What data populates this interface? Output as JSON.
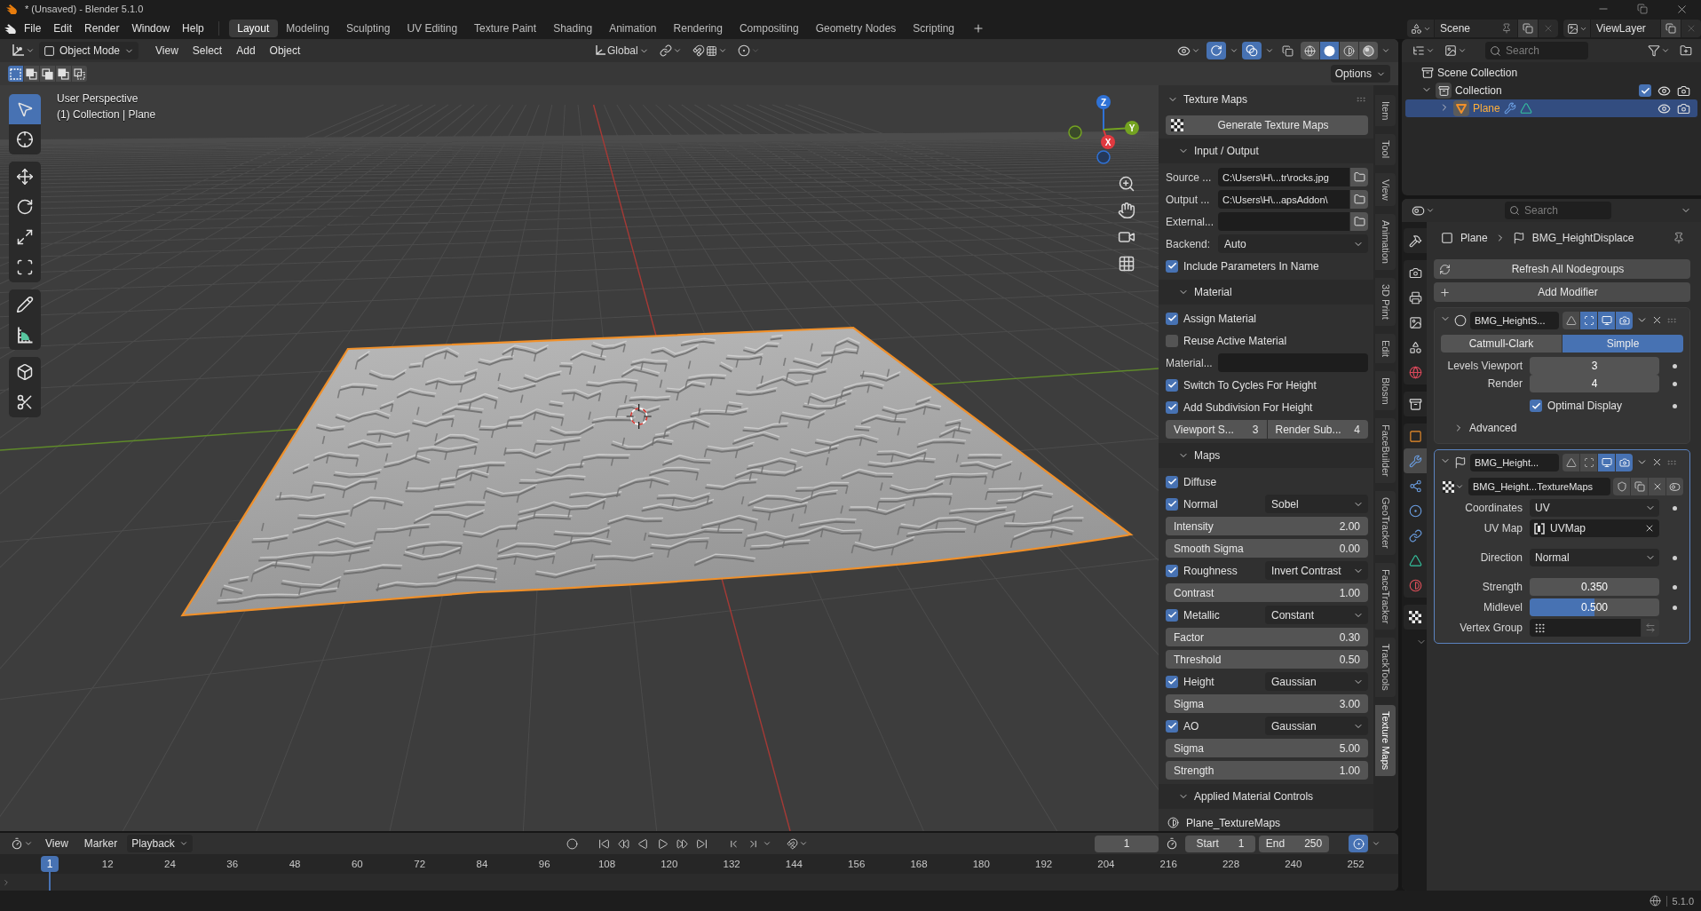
{
  "window": {
    "title": "* (Unsaved) - Blender 5.1.0"
  },
  "menu": [
    "File",
    "Edit",
    "Render",
    "Window",
    "Help"
  ],
  "workspaces": [
    {
      "label": "Layout",
      "selected": true
    },
    {
      "label": "Modeling",
      "selected": false
    },
    {
      "label": "Sculpting",
      "selected": false
    },
    {
      "label": "UV Editing",
      "selected": false
    },
    {
      "label": "Texture Paint",
      "selected": false
    },
    {
      "label": "Shading",
      "selected": false
    },
    {
      "label": "Animation",
      "selected": false
    },
    {
      "label": "Rendering",
      "selected": false
    },
    {
      "label": "Compositing",
      "selected": false
    },
    {
      "label": "Geometry Nodes",
      "selected": false
    },
    {
      "label": "Scripting",
      "selected": false
    }
  ],
  "scene_selector": {
    "scene": "Scene",
    "view_layer": "ViewLayer"
  },
  "viewport": {
    "mode": "Object Mode",
    "menus": [
      "View",
      "Select",
      "Add",
      "Object"
    ],
    "orientation": "Global",
    "show_gizmos": true,
    "show_overlays": true,
    "shading": [
      {
        "kind": "wireframe",
        "selected": false
      },
      {
        "kind": "solid",
        "selected": true
      },
      {
        "kind": "material",
        "selected": false
      },
      {
        "kind": "rendered",
        "selected": false
      }
    ],
    "select_modes": [
      {
        "kind": "set",
        "selected": true
      },
      {
        "kind": "extend",
        "selected": false
      },
      {
        "kind": "subtract",
        "selected": false
      },
      {
        "kind": "invert",
        "selected": false
      },
      {
        "kind": "intersect",
        "selected": false
      }
    ],
    "options": "Options",
    "tool_groups": [
      [
        {
          "kind": "select_box",
          "selected": true
        },
        {
          "kind": "cursor",
          "selected": false
        }
      ],
      [
        {
          "kind": "move",
          "selected": false
        },
        {
          "kind": "rotate",
          "selected": false
        },
        {
          "kind": "scale",
          "selected": false
        },
        {
          "kind": "transform",
          "selected": false
        }
      ],
      [
        {
          "kind": "annotate",
          "selected": false
        },
        {
          "kind": "measure",
          "selected": false
        }
      ],
      [
        {
          "kind": "add_cube",
          "selected": false
        },
        {
          "kind": "cut",
          "selected": false
        }
      ]
    ],
    "overlay_text": [
      "User Perspective",
      "(1) Collection | Plane"
    ],
    "gizmo": [
      {
        "label": "Z",
        "color": "#2f72d6"
      },
      {
        "label": "X",
        "color": "#e0393f"
      },
      {
        "label": "Y",
        "color": "#74a321"
      }
    ]
  },
  "sidebar": {
    "title": "Texture Maps",
    "expanded": true,
    "rows": [
      {
        "kind": "button",
        "label": "Generate Texture Maps"
      },
      {
        "kind": "section",
        "label": "Input / Output",
        "expanded": true
      },
      {
        "kind": "path",
        "label": "Source ...",
        "value": "C:\\Users\\H\\...tr\\rocks.jpg"
      },
      {
        "kind": "path",
        "label": "Output ...",
        "value": "C:\\Users\\H\\...apsAddon\\"
      },
      {
        "kind": "path",
        "label": "External..."
      },
      {
        "kind": "dropdown",
        "label": "Backend:",
        "value": "Auto"
      },
      {
        "kind": "checkbox",
        "label": "Include Parameters In Name",
        "checked": true
      },
      {
        "kind": "section",
        "label": "Material",
        "expanded": true
      },
      {
        "kind": "checkbox",
        "label": "Assign Material",
        "checked": true
      },
      {
        "kind": "checkbox",
        "label": "Reuse Active Material",
        "checked": false
      },
      {
        "kind": "text",
        "label": "Material..."
      },
      {
        "kind": "checkbox",
        "label": "Switch To Cycles For Height",
        "checked": true
      },
      {
        "kind": "checkbox",
        "label": "Add Subdivision For Height",
        "checked": true
      },
      {
        "kind": "pair",
        "fields": [
          {
            "label": "Viewport S...",
            "value": "3"
          },
          {
            "label": "Render Sub...",
            "value": "4"
          }
        ]
      },
      {
        "kind": "section",
        "label": "Maps",
        "expanded": true
      },
      {
        "kind": "checkbox",
        "label": "Diffuse",
        "checked": true
      },
      {
        "kind": "map",
        "label": "Normal",
        "checked": true,
        "value": "Sobel"
      },
      {
        "kind": "number",
        "label": "Intensity",
        "value": "2.00"
      },
      {
        "kind": "number",
        "label": "Smooth Sigma",
        "value": "0.00"
      },
      {
        "kind": "map",
        "label": "Roughness",
        "checked": true,
        "value": "Invert Contrast"
      },
      {
        "kind": "number",
        "label": "Contrast",
        "value": "1.00"
      },
      {
        "kind": "map",
        "label": "Metallic",
        "checked": true,
        "value": "Constant"
      },
      {
        "kind": "number",
        "label": "Factor",
        "value": "0.30"
      },
      {
        "kind": "number",
        "label": "Threshold",
        "value": "0.50"
      },
      {
        "kind": "map",
        "label": "Height",
        "checked": true,
        "value": "Gaussian"
      },
      {
        "kind": "number",
        "label": "Sigma",
        "value": "3.00"
      },
      {
        "kind": "map",
        "label": "AO",
        "checked": true,
        "value": "Gaussian"
      },
      {
        "kind": "number",
        "label": "Sigma",
        "value": "5.00"
      },
      {
        "kind": "number",
        "label": "Strength",
        "value": "1.00"
      },
      {
        "kind": "section",
        "label": "Applied Material Controls",
        "expanded": true
      },
      {
        "kind": "material",
        "label": "Plane_TextureMaps"
      }
    ]
  },
  "sidebar_tabs": [
    {
      "label": "Item",
      "selected": false
    },
    {
      "label": "Tool",
      "selected": false
    },
    {
      "label": "View",
      "selected": false
    },
    {
      "label": "Animation",
      "selected": false
    },
    {
      "label": "3D Print",
      "selected": false
    },
    {
      "label": "Edit",
      "selected": false
    },
    {
      "label": "Blosm",
      "selected": false
    },
    {
      "label": "FaceBuilder",
      "selected": false
    },
    {
      "label": "GeoTracker",
      "selected": false
    },
    {
      "label": "FaceTracker",
      "selected": false
    },
    {
      "label": "TrackTools",
      "selected": false
    },
    {
      "label": "Texture Maps",
      "selected": true
    }
  ],
  "outliner": {
    "search_placeholder": "Search",
    "tree": [
      {
        "label": "Scene Collection",
        "kind": "scene",
        "selected": false,
        "children": [
          {
            "label": "Collection",
            "kind": "collection",
            "expanded": true,
            "checked": true,
            "selected": false,
            "children": [
              {
                "label": "Plane",
                "kind": "object",
                "expanded": false,
                "selected": true
              }
            ]
          }
        ]
      }
    ]
  },
  "properties": {
    "search_placeholder": "Search",
    "tab_groups": [
      [
        {
          "kind": "tool",
          "selected": false
        }
      ],
      [
        {
          "kind": "render",
          "selected": false
        },
        {
          "kind": "output",
          "selected": false
        },
        {
          "kind": "view_layer",
          "selected": false
        },
        {
          "kind": "scene",
          "selected": false
        },
        {
          "kind": "world",
          "selected": false
        }
      ],
      [
        {
          "kind": "collection",
          "selected": false
        }
      ],
      [
        {
          "kind": "object",
          "selected": false
        },
        {
          "kind": "modifiers",
          "selected": true
        },
        {
          "kind": "particles",
          "selected": false
        },
        {
          "kind": "physics",
          "selected": false
        },
        {
          "kind": "constraints",
          "selected": false
        },
        {
          "kind": "data",
          "selected": false
        },
        {
          "kind": "material",
          "selected": false
        }
      ],
      [
        {
          "kind": "texture",
          "selected": false
        }
      ]
    ],
    "breadcrumb": [
      "Plane",
      "BMG_HeightDisplace"
    ],
    "actions": [
      {
        "kind": "refresh",
        "label": "Refresh All Nodegroups"
      },
      {
        "kind": "add",
        "label": "Add Modifier"
      }
    ],
    "modifiers": [
      {
        "name": "BMG_HeightS...",
        "kind": "subdivision",
        "active": false,
        "expanded": true,
        "toggles": [
          {
            "kind": "edit_mode",
            "on": false
          },
          {
            "kind": "cage",
            "on": true
          },
          {
            "kind": "viewport",
            "on": true
          },
          {
            "kind": "render",
            "on": true
          }
        ],
        "groups": [
          [
            {
              "kind": "segmented",
              "options": [
                {
                  "label": "Catmull-Clark",
                  "selected": false
                },
                {
                  "label": "Simple",
                  "selected": true
                }
              ]
            }
          ],
          [
            {
              "kind": "number",
              "label": "Levels Viewport",
              "value": "3"
            },
            {
              "kind": "number",
              "label": "Render",
              "value": "4"
            }
          ],
          [
            {
              "kind": "checkbox",
              "label": "Optimal Display",
              "checked": true
            }
          ],
          [
            {
              "kind": "subpanel",
              "label": "Advanced",
              "expanded": false
            }
          ]
        ]
      },
      {
        "name": "BMG_Height...",
        "kind": "nodes",
        "active": true,
        "expanded": true,
        "toggles": [
          {
            "kind": "edit_mode",
            "on": false
          },
          {
            "kind": "cage",
            "on": false
          },
          {
            "kind": "viewport",
            "on": true
          },
          {
            "kind": "render",
            "on": true
          }
        ],
        "groups": [
          [
            {
              "kind": "node_group",
              "value": "BMG_Height...TextureMaps"
            },
            {
              "kind": "dropdown",
              "label": "Coordinates",
              "value": "UV"
            },
            {
              "kind": "uv_map",
              "label": "UV Map",
              "value": "UVMap"
            }
          ],
          [
            {
              "kind": "dropdown",
              "label": "Direction",
              "value": "Normal"
            }
          ],
          [
            {
              "kind": "number",
              "label": "Strength",
              "value": "0.350"
            },
            {
              "kind": "factor",
              "label": "Midlevel",
              "value": "0.500",
              "level": 0.5
            },
            {
              "kind": "vertex_group",
              "label": "Vertex Group"
            }
          ]
        ]
      }
    ]
  },
  "timeline": {
    "menus": [
      {
        "label": "View",
        "kind": "menu"
      },
      {
        "label": "Marker",
        "kind": "menu"
      },
      {
        "label": "Playback",
        "kind": "dropdown"
      }
    ],
    "current_frame": "1",
    "range": [
      {
        "label": "Start",
        "value": "1"
      },
      {
        "label": "End",
        "value": "250"
      }
    ],
    "playhead": "1",
    "ticks": [
      "12",
      "24",
      "36",
      "48",
      "60",
      "72",
      "84",
      "96",
      "108",
      "120",
      "132",
      "144",
      "156",
      "168",
      "180",
      "192",
      "204",
      "216",
      "228",
      "240",
      "252"
    ]
  },
  "status_bar": {
    "version": "5.1.0"
  }
}
